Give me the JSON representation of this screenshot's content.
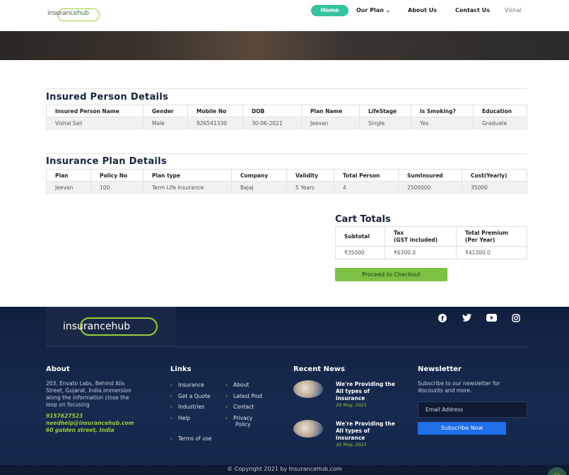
{
  "nav": {
    "logo": "insurancehub",
    "logo_prefix": "i",
    "logo_main": "nsurance",
    "logo_suffix": "hub",
    "home": "Home",
    "our_plan": "Our Plan",
    "about": "About Us",
    "contact": "Contact Us",
    "user": "Vishal"
  },
  "insured": {
    "title": "Insured Person Details",
    "headers": [
      "Insured Person Name",
      "Gender",
      "Mobile No",
      "DOB",
      "Plan Name",
      "LifeStage",
      "Is Smoking?",
      "Education"
    ],
    "row": [
      "Vishal Sali",
      "Male",
      "926541330",
      "30-06-2021",
      "Jeevan",
      "Single",
      "Yes",
      "Graduate"
    ]
  },
  "plan": {
    "title": "Insurance Plan Details",
    "headers": [
      "Plan",
      "Policy No",
      "Plan type",
      "Company",
      "Validity",
      "Total Person",
      "SumInsured",
      "Cost(Yearly)"
    ],
    "row": [
      "Jeevan",
      "100",
      "Term Life Insurance",
      "Bajaj",
      "5 Years",
      "4",
      "2500000",
      "35000"
    ]
  },
  "cart": {
    "title": "Cart Totals",
    "subtotal_label": "Subtotal",
    "tax_label_1": "Tax",
    "tax_label_2": "(GST included)",
    "total_label_1": "Total Premium",
    "total_label_2": "(Per Year)",
    "subtotal": "₹35000",
    "tax": "₹6300.0",
    "total": "₹41300.0",
    "checkout": "Proceed to Checkout"
  },
  "footer": {
    "logo": "insurancehub",
    "about": {
      "heading": "About",
      "lines": [
        "203, Envato Labs, Behind Alis",
        "Street, Gujarat, India.immersion",
        "along the information close the",
        "loop on focusing"
      ],
      "phone": "9157627523",
      "email": "needhelp@insurancehub.com",
      "address": "60 golden street, India"
    },
    "links": {
      "heading": "Links",
      "col1": [
        "Insurance",
        "Get a Quote",
        "Industries",
        "Help",
        "Terms of use"
      ],
      "col2": [
        "About",
        "Latest Post",
        "Contact",
        "Privacy",
        "Policy"
      ]
    },
    "news": {
      "heading": "Recent News",
      "items": [
        {
          "line1": "We're Providing the",
          "line2": "All types of",
          "line3": "insurance",
          "date": "20 May, 2021"
        },
        {
          "line1": "We're Providing the",
          "line2": "All types of",
          "line3": "insurance",
          "date": "20 May, 2021"
        }
      ]
    },
    "newsletter": {
      "heading": "Newsletter",
      "text1": "Subscribe to our newsletter for",
      "text2": "discounts and more.",
      "placeholder": "Email Address",
      "button": "Subscribe Now"
    },
    "copyright": "© Copyright 2021 by InsuranceHub.com"
  },
  "colors": {
    "accent": "#33c4a0",
    "checkout": "#7cc144",
    "footer_bg": "#12203f",
    "subscribe": "#1e6fe8"
  }
}
